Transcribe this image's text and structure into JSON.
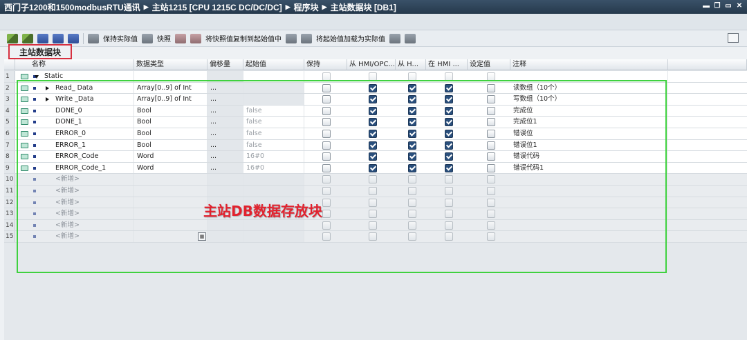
{
  "breadcrumb": [
    "西门子1200和1500modbusRTU通讯",
    "主站1215 [CPU 1215C DC/DC/DC]",
    "程序块",
    "主站数据块 [DB1]"
  ],
  "toolbar": {
    "keep_actual": "保持实际值",
    "snapshot": "快照",
    "copy_snapshot_to_start": "将快照值复制到起始值中",
    "load_start_as_actual": "将起始值加载为实际值"
  },
  "block_label": "主站数据块",
  "columns": {
    "name": "名称",
    "datatype": "数据类型",
    "offset": "偏移量",
    "start_value": "起始值",
    "retain": "保持",
    "hmi_access": "从 HMI/OPC...",
    "hmi_write": "从 H...",
    "hmi_visible": "在 HMI ...",
    "setpoint": "设定值",
    "comment": "注释"
  },
  "rows": [
    {
      "num": "1",
      "name": "Static",
      "type": "",
      "offset": "",
      "start": "",
      "comment": "",
      "kind": "static"
    },
    {
      "num": "2",
      "name": "Read_ Data",
      "type": "Array[0..9] of Int",
      "offset": "...",
      "start": "",
      "comment": "读数组（10个）",
      "kind": "array",
      "checks": [
        false,
        true,
        true,
        true,
        false
      ]
    },
    {
      "num": "3",
      "name": "Write _Data",
      "type": "Array[0..9] of Int",
      "offset": "...",
      "start": "",
      "comment": "写数组（10个）",
      "kind": "array",
      "checks": [
        false,
        true,
        true,
        true,
        false
      ]
    },
    {
      "num": "4",
      "name": "DONE_0",
      "type": "Bool",
      "offset": "...",
      "start": "false",
      "comment": "完成位",
      "kind": "data",
      "checks": [
        false,
        true,
        true,
        true,
        false
      ]
    },
    {
      "num": "5",
      "name": "DONE_1",
      "type": "Bool",
      "offset": "...",
      "start": "false",
      "comment": "完成位1",
      "kind": "data",
      "checks": [
        false,
        true,
        true,
        true,
        false
      ]
    },
    {
      "num": "6",
      "name": "ERROR_0",
      "type": "Bool",
      "offset": "...",
      "start": "false",
      "comment": "错误位",
      "kind": "data",
      "checks": [
        false,
        true,
        true,
        true,
        false
      ]
    },
    {
      "num": "7",
      "name": "ERROR_1",
      "type": "Bool",
      "offset": "...",
      "start": "false",
      "comment": "错误位1",
      "kind": "data",
      "checks": [
        false,
        true,
        true,
        true,
        false
      ]
    },
    {
      "num": "8",
      "name": "ERROR_Code",
      "type": "Word",
      "offset": "...",
      "start": "16#0",
      "comment": "错误代码",
      "kind": "data",
      "checks": [
        false,
        true,
        true,
        true,
        false
      ]
    },
    {
      "num": "9",
      "name": "ERROR_Code_1",
      "type": "Word",
      "offset": "...",
      "start": "16#0",
      "comment": "错误代码1",
      "kind": "data",
      "checks": [
        false,
        true,
        true,
        true,
        false
      ]
    },
    {
      "num": "10",
      "name": "<新增>",
      "kind": "empty"
    },
    {
      "num": "11",
      "name": "<新增>",
      "kind": "empty"
    },
    {
      "num": "12",
      "name": "<新增>",
      "kind": "empty"
    },
    {
      "num": "13",
      "name": "<新增>",
      "kind": "empty"
    },
    {
      "num": "14",
      "name": "<新增>",
      "kind": "empty"
    },
    {
      "num": "15",
      "name": "<新增>",
      "kind": "empty"
    }
  ],
  "overlay_label": "主站DB数据存放块"
}
